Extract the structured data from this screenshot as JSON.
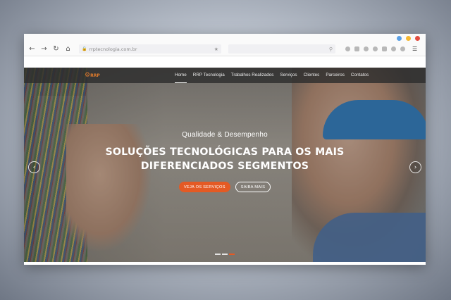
{
  "browser": {
    "url": "rrptecnologia.com.br",
    "traffic_colors": [
      "#5aa0e6",
      "#f5b731",
      "#e24c3f"
    ],
    "nav_icons": [
      "back-arrow-icon",
      "forward-arrow-icon",
      "reload-icon",
      "home-icon"
    ],
    "extension_icons": [
      "cloud-icon",
      "camera-icon",
      "info-icon",
      "user-icon",
      "briefcase-icon",
      "shield-icon",
      "heart-icon",
      "hamburger-menu-icon"
    ]
  },
  "site": {
    "logo_text": "RRP",
    "menu": [
      {
        "label": "Home",
        "active": true
      },
      {
        "label": "RRP Tecnologia"
      },
      {
        "label": "Trabalhos Realizados"
      },
      {
        "label": "Serviços"
      },
      {
        "label": "Clientes"
      },
      {
        "label": "Parceiros"
      },
      {
        "label": "Contatos"
      }
    ],
    "hero": {
      "subtitle": "Qualidade & Desempenho",
      "headline_line1": "SOLUÇÕES TECNOLÓGICAS PARA OS MAIS",
      "headline_line2": "DIFERENCIADOS SEGMENTOS",
      "primary_button": "VEJA OS SERVIÇOS",
      "secondary_button": "SAIBA MAIS",
      "slides": 3,
      "active_slide": 3
    },
    "colors": {
      "accent": "#e45a24",
      "navbar": "#2d2d2d"
    }
  }
}
